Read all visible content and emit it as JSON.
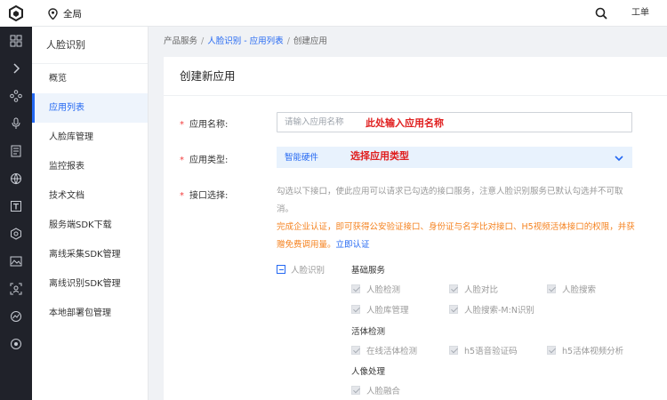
{
  "topbar": {
    "region": "全局",
    "ticket": "工单"
  },
  "sidebar": {
    "title": "人脸识别",
    "items": [
      {
        "label": "概览"
      },
      {
        "label": "应用列表"
      },
      {
        "label": "人脸库管理"
      },
      {
        "label": "监控报表"
      },
      {
        "label": "技术文档"
      },
      {
        "label": "服务端SDK下载"
      },
      {
        "label": "离线采集SDK管理"
      },
      {
        "label": "离线识别SDK管理"
      },
      {
        "label": "本地部署包管理"
      }
    ]
  },
  "breadcrumb": {
    "root": "产品服务",
    "link": "人脸识别 - 应用列表",
    "current": "创建应用"
  },
  "form": {
    "title": "创建新应用",
    "name_label": "应用名称:",
    "name_placeholder": "请输入应用名称",
    "name_annotation": "此处输入应用名称",
    "type_label": "应用类型:",
    "type_value": "智能硬件",
    "type_annotation": "选择应用类型",
    "api_label": "接口选择:",
    "api_desc": "勾选以下接口，使此应用可以请求已勾选的接口服务，注意人脸识别服务已默认勾选并不可取消。",
    "notice_text": "完成企业认证，即可获得公安验证接口、身份证与名字比对接口、H5视频活体接口的权限，并获赠免费调用量。",
    "notice_link": "立即认证",
    "tree_root": "人脸识别",
    "groups": [
      {
        "title": "基础服务",
        "items": [
          "人脸检测",
          "人脸对比",
          "人脸搜索",
          "人脸库管理",
          "人脸搜索-M:N识别"
        ]
      },
      {
        "title": "活体检测",
        "items": [
          "在线活体检测",
          "h5语音验证码",
          "h5活体视频分析"
        ]
      },
      {
        "title": "人像处理",
        "items": [
          "人脸融合"
        ]
      }
    ]
  },
  "colors": {
    "accent": "#2468f2",
    "required": "#f33e3e",
    "annotation": "#e02020",
    "notice": "#f5821f",
    "rail": "#20222a"
  }
}
